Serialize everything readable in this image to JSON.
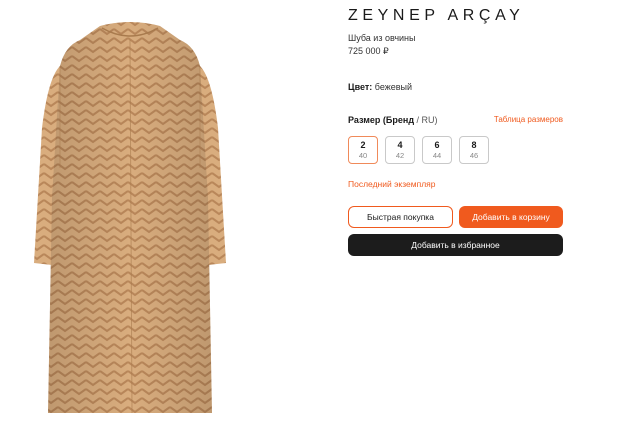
{
  "product": {
    "brand": "ZEYNEP ARÇAY",
    "name": "Шуба из овчины",
    "price": "725 000 ₽",
    "color_label": "Цвет:",
    "color_value": "бежевый",
    "image_color": "#d4a97a",
    "image_stripe_color": "#b07d4e"
  },
  "size": {
    "label": "Размер (Бренд",
    "unit_suffix": "/ RU)",
    "chart_link": "Таблица размеров",
    "options": [
      {
        "brand": "2",
        "ru": "40",
        "selected": true
      },
      {
        "brand": "4",
        "ru": "42",
        "selected": false
      },
      {
        "brand": "6",
        "ru": "44",
        "selected": false
      },
      {
        "brand": "8",
        "ru": "46",
        "selected": false
      }
    ]
  },
  "stock_note": "Последний экземпляр",
  "actions": {
    "quick_buy": "Быстрая покупка",
    "add_to_cart": "Добавить в корзину",
    "add_to_favorites": "Добавить в избранное"
  },
  "colors": {
    "accent": "#f05a1e",
    "dark_button": "#1c1c1c"
  }
}
